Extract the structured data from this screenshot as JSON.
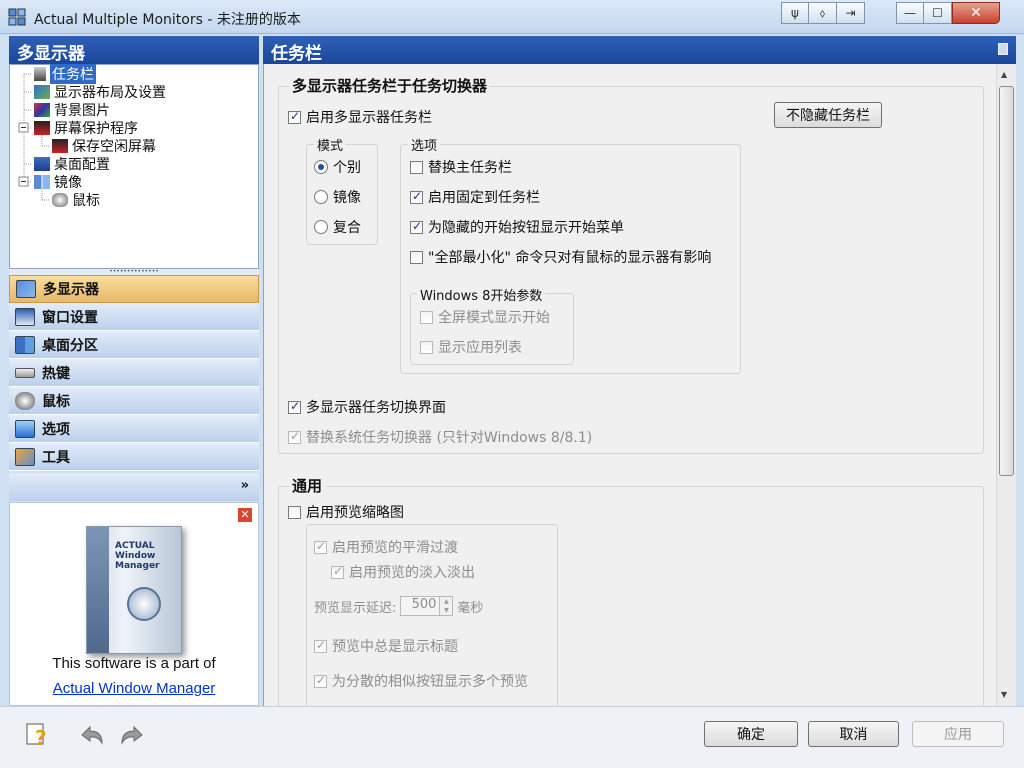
{
  "window": {
    "title": "Actual Multiple Monitors - 未注册的版本",
    "caption_buttons": [
      "pin-icon",
      "pan-icon",
      "restore-icon"
    ],
    "close_label": "✕",
    "minimize_label": "—",
    "maximize_label": "☐"
  },
  "left_header": "多显示器",
  "tree": [
    {
      "label": "任务栏",
      "selected": true
    },
    {
      "label": "显示器布局及设置"
    },
    {
      "label": "背景图片"
    },
    {
      "label": "屏幕保护程序"
    },
    {
      "label": "保存空闲屏幕"
    },
    {
      "label": "桌面配置"
    },
    {
      "label": "镜像"
    },
    {
      "label": "鼠标"
    }
  ],
  "nav": [
    {
      "label": "多显示器",
      "active": true
    },
    {
      "label": "窗口设置"
    },
    {
      "label": "桌面分区"
    },
    {
      "label": "热键"
    },
    {
      "label": "鼠标"
    },
    {
      "label": "选项"
    },
    {
      "label": "工具"
    }
  ],
  "nav_more": "»",
  "promo": {
    "text": "This software is a part of",
    "link": "Actual Window Manager",
    "box_title": "ACTUAL Window Manager",
    "close": "✕"
  },
  "right_header": "任务栏",
  "section1": {
    "title": "多显示器任务栏于任务切换器",
    "enable_taskbar": "启用多显示器任务栏",
    "no_hide_button": "不隐藏任务栏",
    "mode_title": "模式",
    "modes": [
      "个别",
      "镜像",
      "复合"
    ],
    "options_title": "选项",
    "options": [
      "替换主任务栏",
      "启用固定到任务栏",
      "为隐藏的开始按钮显示开始菜单",
      "\"全部最小化\" 命令只对有鼠标的显示器有影响"
    ],
    "win8_title": "Windows 8开始参数",
    "win8_options": [
      "全屏模式显示开始",
      "显示应用列表"
    ],
    "switcher": "多显示器任务切换界面",
    "replace_switcher": "替换系统任务切换器 (只针对Windows 8/8.1)"
  },
  "section2": {
    "title": "通用",
    "enable_preview": "启用预览缩略图",
    "smooth": "启用预览的平滑过渡",
    "fade": "启用预览的淡入淡出",
    "delay_label": "预览显示延迟:",
    "delay_value": "500",
    "delay_unit": "毫秒",
    "show_title": "预览中总是显示标题",
    "multi_preview": "为分散的相似按钮显示多个预览"
  },
  "buttons": {
    "ok": "确定",
    "cancel": "取消",
    "apply": "应用"
  },
  "colors": {
    "header": "#1b4699",
    "selected": "#3169c6",
    "active_nav": "#e8b866",
    "link": "#0033cc"
  }
}
